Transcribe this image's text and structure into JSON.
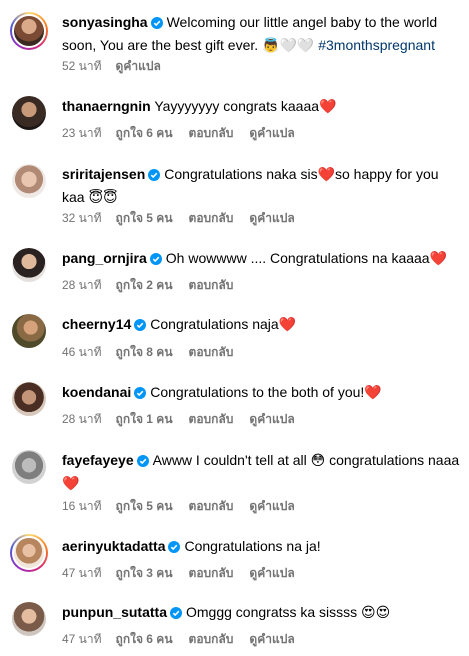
{
  "comments": [
    {
      "username": "sonyasingha",
      "verified": true,
      "text": "Welcoming our little angel baby to the world soon, You are the best gift ever. 👼🤍🤍",
      "hashtag": "#3monthspregnant",
      "time": "52 นาที",
      "likes": "",
      "reply": "",
      "translate": "ดูคำแปล"
    },
    {
      "username": "thanaerngnin",
      "verified": false,
      "text": "Yayyyyyyy congrats kaaaa❤️",
      "time": "23 นาที",
      "likes": "ถูกใจ 6 คน",
      "reply": "ตอบกลับ",
      "translate": "ดูคำแปล"
    },
    {
      "username": "sriritajensen",
      "verified": true,
      "text": "Congratulations naka sis❤️so happy for you kaa 😇😇",
      "time": "32 นาที",
      "likes": "ถูกใจ 5 คน",
      "reply": "ตอบกลับ",
      "translate": "ดูคำแปล"
    },
    {
      "username": "pang_ornjira",
      "verified": true,
      "text": "Oh wowwww .... Congratulations na kaaaa❤️",
      "time": "28 นาที",
      "likes": "ถูกใจ 2 คน",
      "reply": "ตอบกลับ",
      "translate": ""
    },
    {
      "username": "cheerny14",
      "verified": true,
      "text": "Congratulations naja❤️",
      "time": "46 นาที",
      "likes": "ถูกใจ 8 คน",
      "reply": "ตอบกลับ",
      "translate": ""
    },
    {
      "username": "koendanai",
      "verified": true,
      "text": "Congratulations to the both of you!❤️",
      "time": "28 นาที",
      "likes": "ถูกใจ 1 คน",
      "reply": "ตอบกลับ",
      "translate": "ดูคำแปล"
    },
    {
      "username": "fayefayeye",
      "verified": true,
      "text": "Awww I couldn't tell at all 😳 congratulations naaa ❤️",
      "time": "16 นาที",
      "likes": "ถูกใจ 5 คน",
      "reply": "ตอบกลับ",
      "translate": "ดูคำแปล"
    },
    {
      "username": "aerinyuktadatta",
      "verified": true,
      "text": "Congratulations na ja!",
      "time": "47 นาที",
      "likes": "ถูกใจ 3 คน",
      "reply": "ตอบกลับ",
      "translate": "ดูคำแปล"
    },
    {
      "username": "punpun_sutatta",
      "verified": true,
      "text": "Omggg congratss ka sissss 😍😍",
      "time": "47 นาที",
      "likes": "ถูกใจ 6 คน",
      "reply": "ตอบกลับ",
      "translate": "ดูคำแปล"
    }
  ],
  "colors": {
    "verified": "#0095f6",
    "meta": "#737373",
    "hashtag": "#00376b"
  }
}
